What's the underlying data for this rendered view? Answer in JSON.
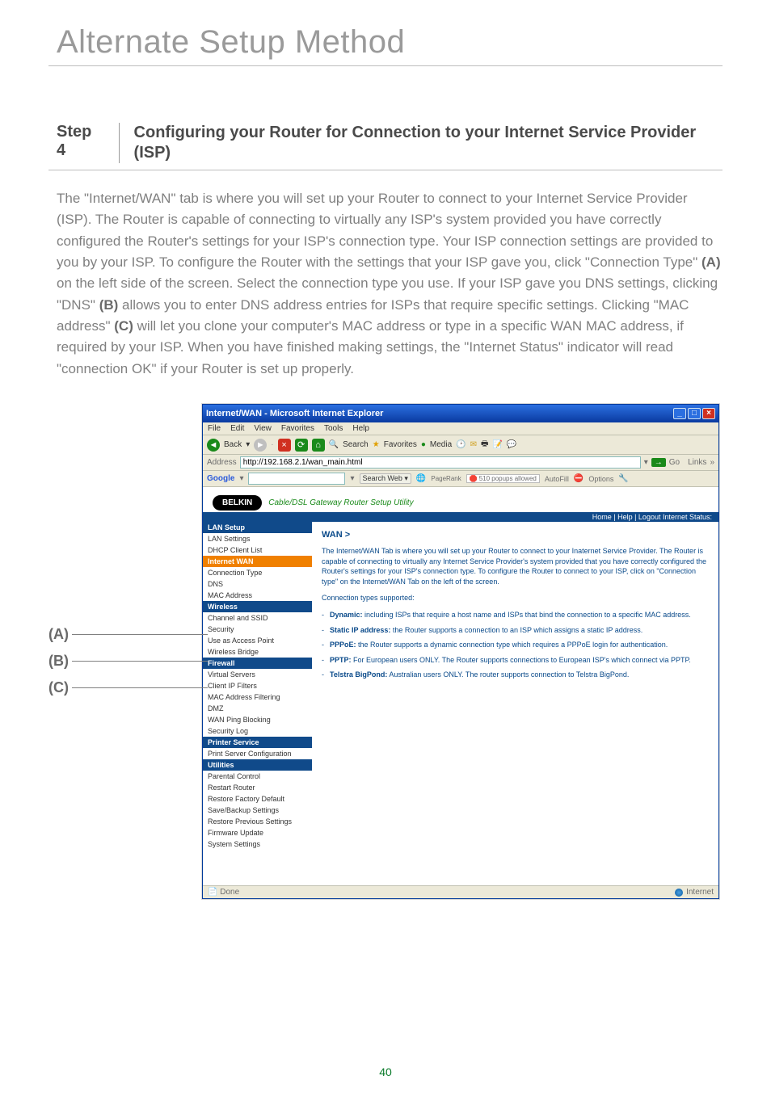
{
  "page": {
    "title": "Alternate Setup Method",
    "number": "40"
  },
  "step": {
    "label": "Step 4",
    "heading": "Configuring your Router for Connection to your Internet Service Provider (ISP)"
  },
  "body": {
    "p1_a": "The \"Internet/WAN\" tab is where you will set up your Router to connect to your Internet Service Provider (ISP). The Router is capable of connecting to virtually any ISP's system provided you have correctly configured the Router's settings for your ISP's connection type. Your ISP connection settings are provided to you by your ISP. To configure the Router with the settings that your ISP gave you, click \"Connection Type\" ",
    "boldA": "(A)",
    "p1_b": " on the left side of the screen. Select the connection type you use. If your ISP gave you DNS settings, clicking \"DNS\" ",
    "boldB": "(B)",
    "p1_c": " allows you to enter DNS address entries for ISPs that require specific settings. Clicking \"MAC address\" ",
    "boldC": "(C)",
    "p1_d": " will let you clone your computer's MAC address or type in a specific WAN MAC address, if required by your ISP. When you have finished making settings, the \"Internet Status\" indicator will read \"connection OK\" if your Router is set up properly."
  },
  "callouts": {
    "a": "(A)",
    "b": "(B)",
    "c": "(C)"
  },
  "browser": {
    "title": "Internet/WAN - Microsoft Internet Explorer",
    "menu": [
      "File",
      "Edit",
      "View",
      "Favorites",
      "Tools",
      "Help"
    ],
    "toolbar": {
      "back": "Back",
      "search": "Search",
      "favorites": "Favorites",
      "media": "Media"
    },
    "address_label": "Address",
    "address_value": "http://192.168.2.1/wan_main.html",
    "go": "Go",
    "links": "Links",
    "google": {
      "logo": "Google",
      "search_btn": "Search Web",
      "pagerank": "PageRank",
      "popups": "510 popups allowed",
      "autofill": "AutoFill",
      "options": "Options"
    },
    "belkin": {
      "logo": "BELKIN",
      "tag": "Cable/DSL Gateway Router Setup Utility",
      "homestrip": "Home | Help | Logout    Internet Status:"
    },
    "sidebar": {
      "lan_setup": "LAN Setup",
      "lan_settings": "LAN Settings",
      "dhcp": "DHCP Client List",
      "internet_wan": "Internet WAN",
      "conn_type": "Connection Type",
      "dns": "DNS",
      "mac": "MAC Address",
      "wireless": "Wireless",
      "channel": "Channel and SSID",
      "security": "Security",
      "useap": "Use as Access Point",
      "bridge": "Wireless Bridge",
      "firewall": "Firewall",
      "vs": "Virtual Servers",
      "cif": "Client IP Filters",
      "macf": "MAC Address Filtering",
      "dmz": "DMZ",
      "wanping": "WAN Ping Blocking",
      "seclog": "Security Log",
      "printsrv": "Printer Service",
      "psc": "Print Server Configuration",
      "util": "Utilities",
      "parental": "Parental Control",
      "restart": "Restart Router",
      "rfd": "Restore Factory Default",
      "sbs": "Save/Backup Settings",
      "rps": "Restore Previous Settings",
      "fwu": "Firmware Update",
      "syset": "System Settings"
    },
    "content": {
      "heading": "WAN >",
      "intro": "The Internet/WAN Tab is where you will set up your Router to connect to your Inaternet Service Provider. The Router is capable of connecting to virtually any Internet Service Provider's system provided that you have correctly configured the Router's settings for your ISP's connection type. To configure the Router to connect to your ISP, click on \"Connection type\" on the Internet/WAN Tab on the left of the screen.",
      "supported": "Connection types supported:",
      "items": [
        {
          "b": "Dynamic:",
          "t": " including ISPs that require a host name and ISPs that bind the connection to a specific MAC address."
        },
        {
          "b": "Static IP address:",
          "t": " the Router supports a connection to an ISP which assigns a static IP address."
        },
        {
          "b": "PPPoE:",
          "t": " the Router supports a dynamic connection type which requires a PPPoE login for authentication."
        },
        {
          "b": "PPTP:",
          "t": " For European users ONLY. The Router supports connections to European ISP's which connect via PPTP."
        },
        {
          "b": "Telstra BigPond:",
          "t": " Australian users ONLY. The router supports connection to Telstra BigPond."
        }
      ]
    },
    "status": {
      "done": "Done",
      "zone": "Internet"
    }
  }
}
